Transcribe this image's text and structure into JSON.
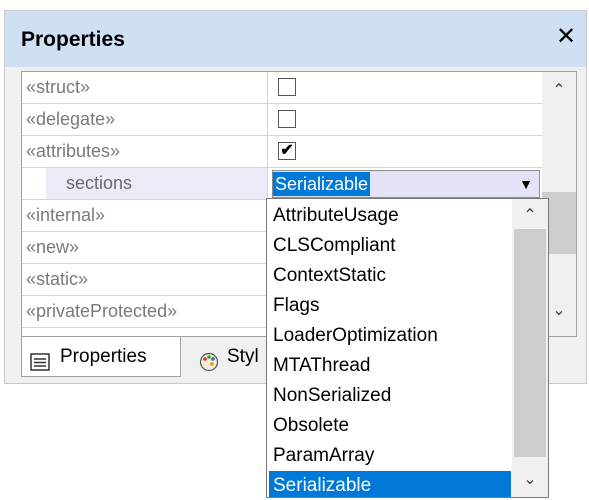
{
  "window": {
    "title": "Properties",
    "close_glyph": "✕"
  },
  "properties": [
    {
      "name": "«struct»",
      "type": "checkbox",
      "checked": false
    },
    {
      "name": "«delegate»",
      "type": "checkbox",
      "checked": false
    },
    {
      "name": "«attributes»",
      "type": "checkbox",
      "checked": true,
      "check_glyph": "✔"
    },
    {
      "name": "sections",
      "type": "combo",
      "value": "Serializable"
    },
    {
      "name": "«internal»",
      "type": "checkbox"
    },
    {
      "name": "«new»",
      "type": "checkbox"
    },
    {
      "name": "«static»",
      "type": "checkbox"
    },
    {
      "name": "«privateProtected»",
      "type": "checkbox"
    }
  ],
  "combo": {
    "arrow_glyph": "▼"
  },
  "scrollbar": {
    "up_glyph": "⌃",
    "down_glyph": "⌄"
  },
  "tabs": [
    {
      "label": "Properties",
      "icon": "properties-icon",
      "active": true
    },
    {
      "label": "Styles",
      "visible_label": "Styl",
      "icon": "palette-icon",
      "active": false
    }
  ],
  "dropdown": {
    "options": [
      "AttributeUsage",
      "CLSCompliant",
      "ContextStatic",
      "Flags",
      "LoaderOptimization",
      "MTAThread",
      "NonSerialized",
      "Obsolete",
      "ParamArray",
      "Serializable"
    ],
    "selected": "Serializable",
    "up_glyph": "⌃",
    "down_glyph": "⌄"
  },
  "colors": {
    "selection": "#0078d7",
    "titlebar": "#cfe0f5",
    "sub_row": "#ececf8"
  }
}
